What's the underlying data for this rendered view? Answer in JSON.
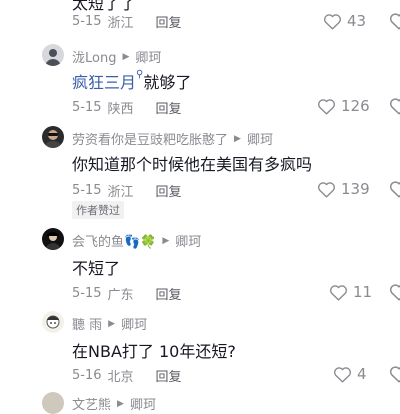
{
  "top_partial": {
    "content": "太短了了",
    "date": "5-15",
    "location": "浙江",
    "reply_label": "回复",
    "likes": "43"
  },
  "comments": [
    {
      "username": "泷Long",
      "reply_to": "卿珂",
      "content_link": "疯狂三月",
      "content_rest": "就够了",
      "date": "5-15",
      "location": "陕西",
      "reply_label": "回复",
      "likes": "126",
      "avatar_icon": "gray-avatar-icon"
    },
    {
      "username": "劳资看你是豆豉粑吃胀憨了",
      "reply_to": "卿珂",
      "content": "你知道那个时候他在美国有多疯吗",
      "date": "5-15",
      "location": "浙江",
      "reply_label": "回复",
      "likes": "139",
      "badge": "作者赞过",
      "avatar_icon": "dark-avatar-icon"
    },
    {
      "username": "会飞的鱼👣🍀",
      "reply_to": "卿珂",
      "content": "不短了",
      "date": "5-15",
      "location": "广东",
      "reply_label": "回复",
      "likes": "11",
      "avatar_icon": "black-avatar-icon"
    },
    {
      "username": "聽 雨",
      "reply_to": "卿珂",
      "content": "在NBA打了 10年还短?",
      "date": "5-16",
      "location": "北京",
      "reply_label": "回复",
      "likes": "4",
      "avatar_icon": "cartoon-avatar-icon"
    }
  ],
  "bottom_partial": {
    "username": "文艺熊",
    "reply_to": "卿珂"
  },
  "colors": {
    "text": "#161823",
    "meta": "#8a8b91",
    "link": "#3a5fa8"
  }
}
